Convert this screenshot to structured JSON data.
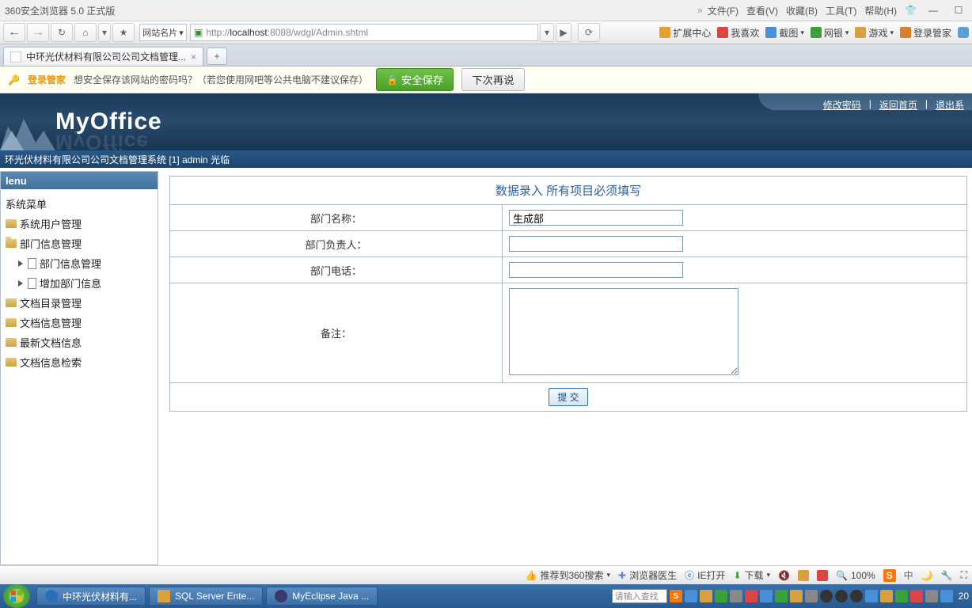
{
  "browser": {
    "title": "360安全浏览器 5.0 正式版",
    "menus": [
      "文件(F)",
      "查看(V)",
      "收藏(B)",
      "工具(T)",
      "帮助(H)"
    ],
    "address_label": "网站名片",
    "address_prefix": "http://",
    "address_host": "localhost",
    "address_rest": ":8088/wdgl/Admin.shtml",
    "toolbar": {
      "ext_center": "扩展中心",
      "like": "我喜欢",
      "screenshot": "截图",
      "netbank": "网银",
      "game": "游戏",
      "login_mgr": "登录管家"
    }
  },
  "tab": {
    "title": "中环光伏材料有限公司公司文档管理..."
  },
  "save_bar": {
    "lead": "登录管家",
    "msg": "想安全保存该网站的密码吗？（若您使用网吧等公共电脑不建议保存）",
    "save_btn": "安全保存",
    "later_btn": "下次再说"
  },
  "app": {
    "logo": "MyOffice",
    "links": [
      "修改密码",
      "返回首页",
      "退出系"
    ],
    "status": "环光伏材料有限公司公司文档管理系统 [1] admin 光临"
  },
  "sidebar": {
    "head": "lenu",
    "root_label": "系统菜单",
    "items": [
      {
        "label": "系统用户管理",
        "type": "folder"
      },
      {
        "label": "部门信息管理",
        "type": "folder_open"
      },
      {
        "label": "部门信息管理",
        "type": "page",
        "sub": true
      },
      {
        "label": "增加部门信息",
        "type": "page",
        "sub": true
      },
      {
        "label": "文档目录管理",
        "type": "folder"
      },
      {
        "label": "文档信息管理",
        "type": "folder"
      },
      {
        "label": "最新文档信息",
        "type": "folder"
      },
      {
        "label": "文档信息检索",
        "type": "folder"
      }
    ]
  },
  "form": {
    "header": "数据录入 所有项目必须填写",
    "fields": {
      "dept_name": {
        "label": "部门名称：",
        "value": "生成部"
      },
      "dept_head": {
        "label": "部门负责人：",
        "value": ""
      },
      "dept_phone": {
        "label": "部门电话：",
        "value": ""
      },
      "remark": {
        "label": "备注：",
        "value": ""
      }
    },
    "submit": "提 交"
  },
  "footer": {
    "recommend": "推荐到360搜索",
    "doctor": "浏览器医生",
    "ie_open": "IE打开",
    "download": "下载",
    "zoom": "100%"
  },
  "taskbar": {
    "items": [
      "中环光伏材料有...",
      "SQL Server Ente...",
      "MyEclipse Java ..."
    ],
    "search_placeholder": "请输入查找",
    "time_suffix": "20"
  }
}
